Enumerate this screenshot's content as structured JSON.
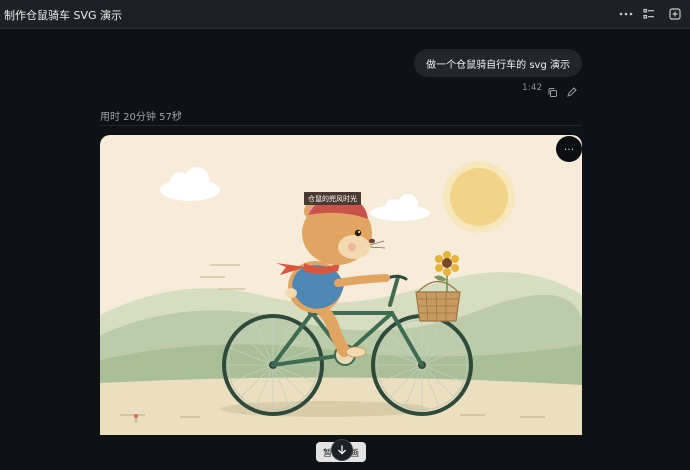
{
  "window": {
    "title": "制作仓鼠骑车 SVG 演示"
  },
  "toolbar": {
    "more_icon": "ellipsis-icon",
    "outline_icon": "checklist-icon",
    "sidebar_icon": "add-panel-icon"
  },
  "user_message": {
    "text": "做一个仓鼠骑自行车的 svg 演示",
    "time": "1:42"
  },
  "assistant": {
    "thinking_label": "用时 20分钟 57秒",
    "chevron": "›"
  },
  "artifact": {
    "caption": "仓鼠的兜风时光",
    "more_label": "···",
    "pause_label": "暂停动画",
    "colors": {
      "background": "#f6ecd9",
      "sun": "#f2d489",
      "hills": "#b9c9a6",
      "bike": "#3f6b52",
      "hamster": "#e2a561",
      "scarf": "#d9553f",
      "shirt": "#4f87b4"
    }
  }
}
